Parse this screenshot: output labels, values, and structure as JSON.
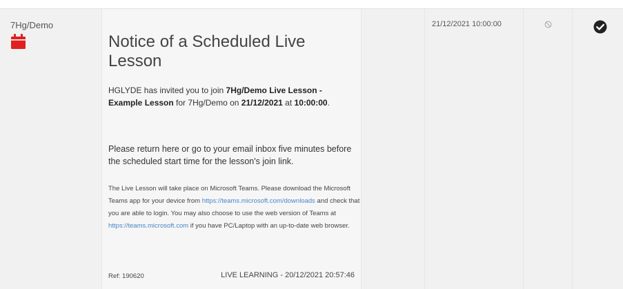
{
  "row": {
    "group": "7Hg/Demo",
    "group_icon": "calendar-icon",
    "title": "Notice of a Scheduled Live Lesson",
    "invite": {
      "pre": "HGLYDE has invited you to join ",
      "lesson": "7Hg/Demo Live Lesson - Example Lesson",
      "mid1": " for 7Hg/Demo on ",
      "date": "21/12/2021",
      "mid2": " at ",
      "time": "10:00:00",
      "post": "."
    },
    "return_text": "Please return here or go to your email inbox five minutes before the scheduled start time for the lesson's join link.",
    "info": {
      "p1": "The Live Lesson will take place on Microsoft Teams. Please download the Microsoft Teams app for your device from ",
      "link1": "https://teams.microsoft.com/downloads",
      "p2": " and check that you are able to login. You may also choose to use the web version of Teams at ",
      "link2": "https://teams.microsoft.com",
      "p3": " if you have PC/Laptop with an up-to-date web browser."
    },
    "ref": "Ref: 190620",
    "source": "LIVE LEARNING - 20/12/2021 20:57:46",
    "datetime": "21/12/2021 10:00:00",
    "flag_icon": "no-entry-icon",
    "action_icon": "check-circle-icon",
    "accent_color": "#e02020"
  }
}
